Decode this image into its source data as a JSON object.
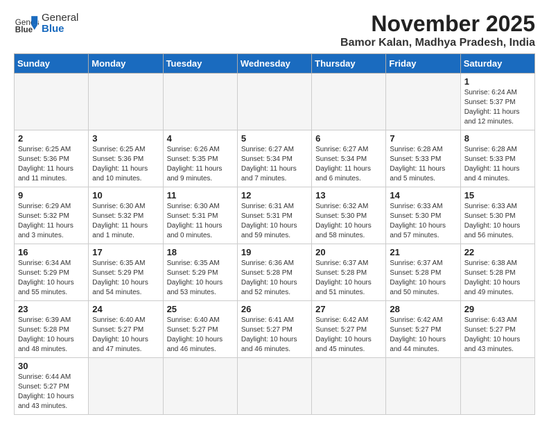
{
  "header": {
    "logo_text_normal": "General",
    "logo_text_bold": "Blue",
    "month_title": "November 2025",
    "location": "Bamor Kalan, Madhya Pradesh, India"
  },
  "weekdays": [
    "Sunday",
    "Monday",
    "Tuesday",
    "Wednesday",
    "Thursday",
    "Friday",
    "Saturday"
  ],
  "weeks": [
    [
      {
        "day": "",
        "info": ""
      },
      {
        "day": "",
        "info": ""
      },
      {
        "day": "",
        "info": ""
      },
      {
        "day": "",
        "info": ""
      },
      {
        "day": "",
        "info": ""
      },
      {
        "day": "",
        "info": ""
      },
      {
        "day": "1",
        "info": "Sunrise: 6:24 AM\nSunset: 5:37 PM\nDaylight: 11 hours\nand 12 minutes."
      }
    ],
    [
      {
        "day": "2",
        "info": "Sunrise: 6:25 AM\nSunset: 5:36 PM\nDaylight: 11 hours\nand 11 minutes."
      },
      {
        "day": "3",
        "info": "Sunrise: 6:25 AM\nSunset: 5:36 PM\nDaylight: 11 hours\nand 10 minutes."
      },
      {
        "day": "4",
        "info": "Sunrise: 6:26 AM\nSunset: 5:35 PM\nDaylight: 11 hours\nand 9 minutes."
      },
      {
        "day": "5",
        "info": "Sunrise: 6:27 AM\nSunset: 5:34 PM\nDaylight: 11 hours\nand 7 minutes."
      },
      {
        "day": "6",
        "info": "Sunrise: 6:27 AM\nSunset: 5:34 PM\nDaylight: 11 hours\nand 6 minutes."
      },
      {
        "day": "7",
        "info": "Sunrise: 6:28 AM\nSunset: 5:33 PM\nDaylight: 11 hours\nand 5 minutes."
      },
      {
        "day": "8",
        "info": "Sunrise: 6:28 AM\nSunset: 5:33 PM\nDaylight: 11 hours\nand 4 minutes."
      }
    ],
    [
      {
        "day": "9",
        "info": "Sunrise: 6:29 AM\nSunset: 5:32 PM\nDaylight: 11 hours\nand 3 minutes."
      },
      {
        "day": "10",
        "info": "Sunrise: 6:30 AM\nSunset: 5:32 PM\nDaylight: 11 hours\nand 1 minute."
      },
      {
        "day": "11",
        "info": "Sunrise: 6:30 AM\nSunset: 5:31 PM\nDaylight: 11 hours\nand 0 minutes."
      },
      {
        "day": "12",
        "info": "Sunrise: 6:31 AM\nSunset: 5:31 PM\nDaylight: 10 hours\nand 59 minutes."
      },
      {
        "day": "13",
        "info": "Sunrise: 6:32 AM\nSunset: 5:30 PM\nDaylight: 10 hours\nand 58 minutes."
      },
      {
        "day": "14",
        "info": "Sunrise: 6:33 AM\nSunset: 5:30 PM\nDaylight: 10 hours\nand 57 minutes."
      },
      {
        "day": "15",
        "info": "Sunrise: 6:33 AM\nSunset: 5:30 PM\nDaylight: 10 hours\nand 56 minutes."
      }
    ],
    [
      {
        "day": "16",
        "info": "Sunrise: 6:34 AM\nSunset: 5:29 PM\nDaylight: 10 hours\nand 55 minutes."
      },
      {
        "day": "17",
        "info": "Sunrise: 6:35 AM\nSunset: 5:29 PM\nDaylight: 10 hours\nand 54 minutes."
      },
      {
        "day": "18",
        "info": "Sunrise: 6:35 AM\nSunset: 5:29 PM\nDaylight: 10 hours\nand 53 minutes."
      },
      {
        "day": "19",
        "info": "Sunrise: 6:36 AM\nSunset: 5:28 PM\nDaylight: 10 hours\nand 52 minutes."
      },
      {
        "day": "20",
        "info": "Sunrise: 6:37 AM\nSunset: 5:28 PM\nDaylight: 10 hours\nand 51 minutes."
      },
      {
        "day": "21",
        "info": "Sunrise: 6:37 AM\nSunset: 5:28 PM\nDaylight: 10 hours\nand 50 minutes."
      },
      {
        "day": "22",
        "info": "Sunrise: 6:38 AM\nSunset: 5:28 PM\nDaylight: 10 hours\nand 49 minutes."
      }
    ],
    [
      {
        "day": "23",
        "info": "Sunrise: 6:39 AM\nSunset: 5:28 PM\nDaylight: 10 hours\nand 48 minutes."
      },
      {
        "day": "24",
        "info": "Sunrise: 6:40 AM\nSunset: 5:27 PM\nDaylight: 10 hours\nand 47 minutes."
      },
      {
        "day": "25",
        "info": "Sunrise: 6:40 AM\nSunset: 5:27 PM\nDaylight: 10 hours\nand 46 minutes."
      },
      {
        "day": "26",
        "info": "Sunrise: 6:41 AM\nSunset: 5:27 PM\nDaylight: 10 hours\nand 46 minutes."
      },
      {
        "day": "27",
        "info": "Sunrise: 6:42 AM\nSunset: 5:27 PM\nDaylight: 10 hours\nand 45 minutes."
      },
      {
        "day": "28",
        "info": "Sunrise: 6:42 AM\nSunset: 5:27 PM\nDaylight: 10 hours\nand 44 minutes."
      },
      {
        "day": "29",
        "info": "Sunrise: 6:43 AM\nSunset: 5:27 PM\nDaylight: 10 hours\nand 43 minutes."
      }
    ],
    [
      {
        "day": "30",
        "info": "Sunrise: 6:44 AM\nSunset: 5:27 PM\nDaylight: 10 hours\nand 43 minutes."
      },
      {
        "day": "",
        "info": ""
      },
      {
        "day": "",
        "info": ""
      },
      {
        "day": "",
        "info": ""
      },
      {
        "day": "",
        "info": ""
      },
      {
        "day": "",
        "info": ""
      },
      {
        "day": "",
        "info": ""
      }
    ]
  ]
}
